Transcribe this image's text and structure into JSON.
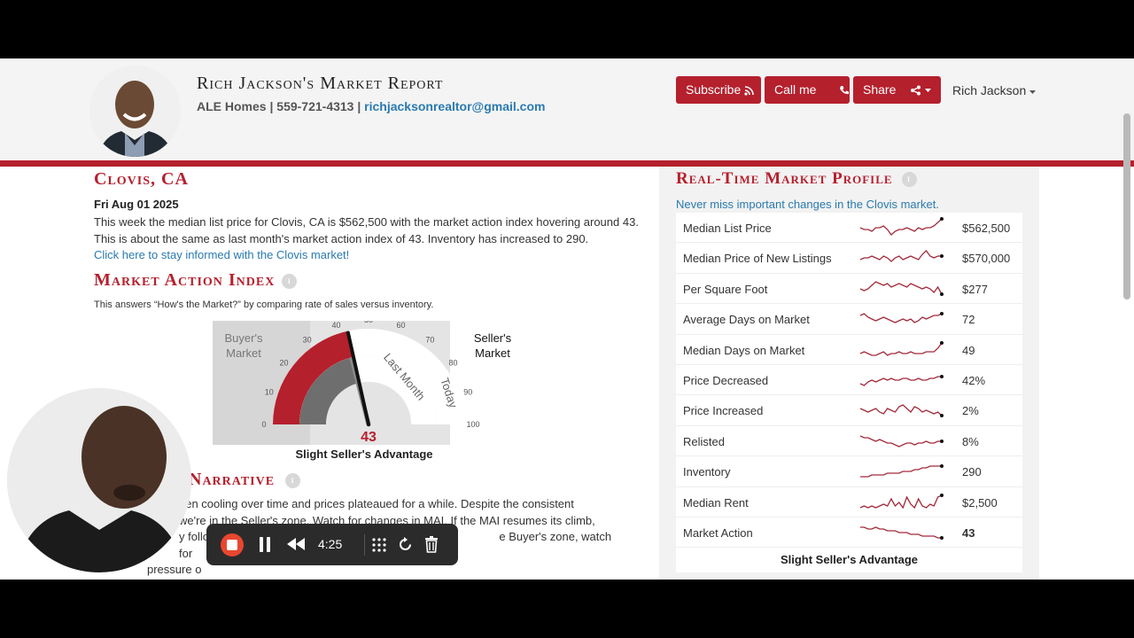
{
  "header": {
    "title": "Rich Jackson's Market Report",
    "company": "ALE Homes",
    "phone": "559-721-4313",
    "sep": "|",
    "email": "richjacksonrealtor@gmail.com",
    "buttons": {
      "subscribe": "Subscribe",
      "call": "Call me",
      "share": "Share"
    },
    "user": "Rich Jackson"
  },
  "summary": {
    "city": "Clovis, CA",
    "date": "Fri Aug 01 2025",
    "text": "This week the median list price for Clovis, CA is $562,500 with the market action index hovering around 43. This is about the same as last month's market action index of 43. Inventory has increased to 290.",
    "link": "Click here to stay informed with the Clovis market!"
  },
  "mai": {
    "title": "Market Action Index",
    "description": "This answers “How's the Market?” by comparing rate of sales versus inventory.",
    "buyers": [
      "Buyer's",
      "Market"
    ],
    "sellers": [
      "Seller's",
      "Market"
    ],
    "ticks": [
      "0",
      "10",
      "20",
      "30",
      "40",
      "50",
      "60",
      "70",
      "80",
      "90",
      "100"
    ],
    "last_month_label": "Last Month",
    "today_label": "Today",
    "value": 43,
    "value_text": "43",
    "caption": "Slight Seller's Advantage"
  },
  "narrative": {
    "title": "Market Narrative",
    "title_visible": "Narrative",
    "line1": "een cooling over time and prices plateaued for a while. Despite the consistent",
    "line2": " we're in the Seller's zone. Watch for changes in MAI. If the MAI resumes its climb,",
    "line3": "y follow",
    "line3b": "e Buyer's zone, watch for",
    "line4": "pressure o"
  },
  "profile": {
    "title": "Real-Time Market Profile",
    "subtitle": "Never miss important changes in the Clovis market.",
    "rows": [
      {
        "label": "Median List Price",
        "value": "$562,500",
        "trend": [
          5,
          4,
          4,
          3,
          5,
          5,
          6,
          4,
          1,
          3,
          4,
          4,
          5,
          4,
          3,
          5,
          4,
          5,
          5,
          6,
          8,
          10
        ]
      },
      {
        "label": "Median Price of New Listings",
        "value": "$570,000",
        "trend": [
          4,
          5,
          5,
          6,
          5,
          4,
          6,
          5,
          3,
          5,
          6,
          4,
          5,
          6,
          5,
          4,
          7,
          9,
          6,
          5,
          6,
          6
        ]
      },
      {
        "label": "Per Square Foot",
        "value": "$277",
        "trend": [
          5,
          4,
          5,
          7,
          9,
          8,
          7,
          8,
          6,
          7,
          8,
          7,
          6,
          8,
          7,
          6,
          5,
          6,
          5,
          3,
          6,
          2
        ]
      },
      {
        "label": "Average Days on Market",
        "value": "72",
        "trend": [
          7,
          8,
          6,
          5,
          4,
          5,
          6,
          5,
          4,
          3,
          4,
          5,
          4,
          5,
          3,
          4,
          6,
          5,
          6,
          7,
          7,
          8
        ]
      },
      {
        "label": "Median Days on Market",
        "value": "49",
        "trend": [
          3,
          4,
          3,
          2,
          2,
          3,
          4,
          2,
          3,
          3,
          4,
          3,
          3,
          4,
          3,
          3,
          3,
          4,
          4,
          4,
          6,
          9
        ]
      },
      {
        "label": "Price Decreased",
        "value": "42%",
        "trend": [
          3,
          2,
          4,
          5,
          4,
          5,
          6,
          5,
          6,
          5,
          5,
          6,
          6,
          5,
          5,
          6,
          5,
          5,
          6,
          6,
          7,
          7
        ]
      },
      {
        "label": "Price Increased",
        "value": "2%",
        "trend": [
          6,
          5,
          4,
          5,
          6,
          4,
          3,
          6,
          5,
          4,
          7,
          8,
          6,
          4,
          7,
          6,
          4,
          5,
          4,
          3,
          4,
          2
        ]
      },
      {
        "label": "Relisted",
        "value": "8%",
        "trend": [
          8,
          7,
          7,
          6,
          5,
          6,
          5,
          4,
          4,
          3,
          2,
          3,
          4,
          4,
          3,
          4,
          4,
          5,
          4,
          4,
          5,
          5
        ]
      },
      {
        "label": "Inventory",
        "value": "290",
        "trend": [
          2,
          2,
          2,
          3,
          3,
          3,
          3,
          4,
          4,
          4,
          4,
          5,
          5,
          5,
          6,
          6,
          7,
          7,
          8,
          8,
          8,
          8
        ]
      },
      {
        "label": "Median Rent",
        "value": "$2,500",
        "trend": [
          2,
          3,
          2,
          3,
          2,
          3,
          4,
          3,
          7,
          3,
          5,
          2,
          8,
          4,
          2,
          7,
          3,
          2,
          4,
          3,
          8,
          9
        ]
      },
      {
        "label": "Market Action",
        "value": "43",
        "trend": [
          8,
          8,
          7,
          7,
          8,
          7,
          7,
          6,
          6,
          6,
          5,
          5,
          5,
          4,
          4,
          4,
          3,
          3,
          3,
          3,
          2,
          2
        ]
      }
    ],
    "footer": "Slight Seller's Advantage"
  },
  "recorder": {
    "time": "4:25"
  },
  "colors": {
    "accent": "#b5202d",
    "link": "#2a7ab0"
  }
}
